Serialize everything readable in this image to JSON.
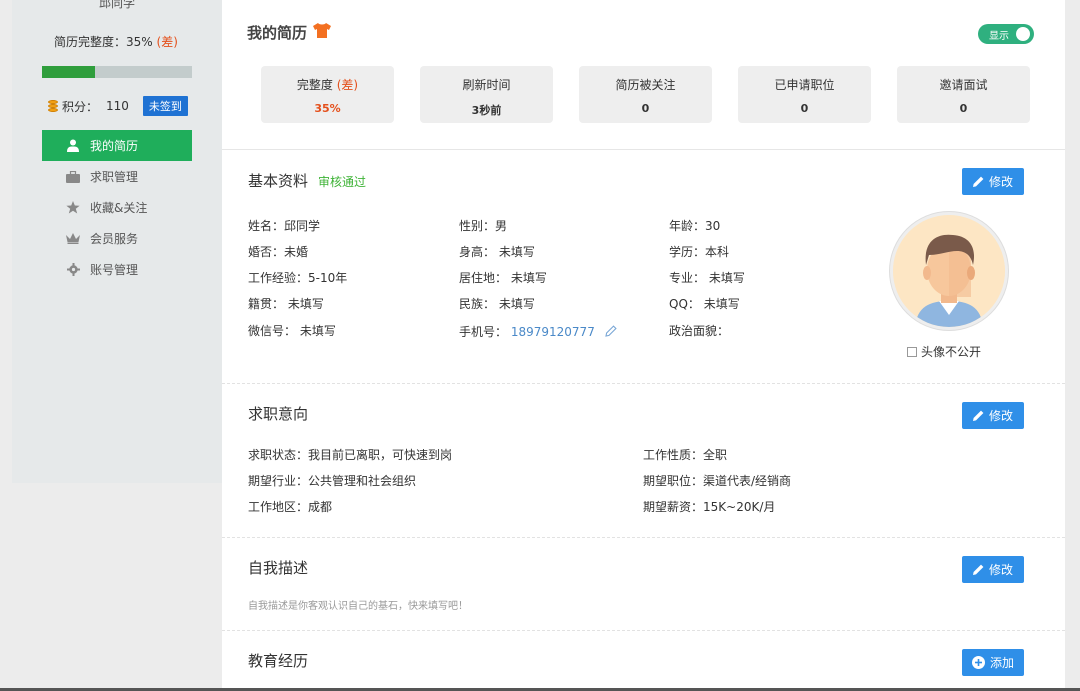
{
  "sidebar": {
    "username": "邱同学",
    "completion_label": "简历完整度：35%",
    "completion_grade": "(差)",
    "progress": 0.35,
    "points_label": "积分：",
    "points_value": "110",
    "checkin_label": "未签到",
    "nav": [
      {
        "label": "我的简历",
        "icon": "user-icon",
        "active": true
      },
      {
        "label": "求职管理",
        "icon": "briefcase-icon",
        "active": false
      },
      {
        "label": "收藏&关注",
        "icon": "star-icon",
        "active": false
      },
      {
        "label": "会员服务",
        "icon": "crown-icon",
        "active": false
      },
      {
        "label": "账号管理",
        "icon": "gear-icon",
        "active": false
      }
    ]
  },
  "resume": {
    "title": "我的简历",
    "toggle_label": "显示",
    "stats": [
      {
        "label": "完整度",
        "label_extra": "(差)",
        "value": "35%",
        "red": true
      },
      {
        "label": "刷新时间",
        "label_extra": "",
        "value": "3秒前",
        "red": false
      },
      {
        "label": "简历被关注",
        "label_extra": "",
        "value": "0",
        "red": false
      },
      {
        "label": "已申请职位",
        "label_extra": "",
        "value": "0",
        "red": false
      },
      {
        "label": "邀请面试",
        "label_extra": "",
        "value": "0",
        "red": false
      }
    ]
  },
  "basic": {
    "title": "基本资料",
    "status": "审核通过",
    "edit_label": "修改",
    "name": "姓名：邱同学",
    "gender": "性别：男",
    "age": "年龄：30",
    "marital": "婚否：未婚",
    "height": "身高：  未填写",
    "education": "学历：本科",
    "experience": "工作经验：5-10年",
    "residence": "居住地：  未填写",
    "major": "专业：  未填写",
    "origin": "籍贯：  未填写",
    "ethnicity": "民族：  未填写",
    "qq": "QQ：  未填写",
    "wechat": "微信号：  未填写",
    "phone_label": "手机号：",
    "phone": "18979120777",
    "political": "政治面貌：",
    "avatar_private": "头像不公开"
  },
  "intent": {
    "title": "求职意向",
    "edit_label": "修改",
    "status": "求职状态：我目前已离职，可快速到岗",
    "nature": "工作性质：全职",
    "industry": "期望行业：公共管理和社会组织",
    "position": "期望职位：渠道代表/经销商",
    "region": "工作地区：成都",
    "salary": "期望薪资：15K~20K/月"
  },
  "selfdesc": {
    "title": "自我描述",
    "edit_label": "修改",
    "hint": "自我描述是你客观认识自己的基石，快来填写吧！"
  },
  "education": {
    "title": "教育经历",
    "add_label": "添加"
  },
  "colors": {
    "accent_green": "#1fae5b",
    "edit_blue": "#2f8fe8",
    "poor_red": "#e4501c",
    "approved_green": "#3fb337"
  }
}
